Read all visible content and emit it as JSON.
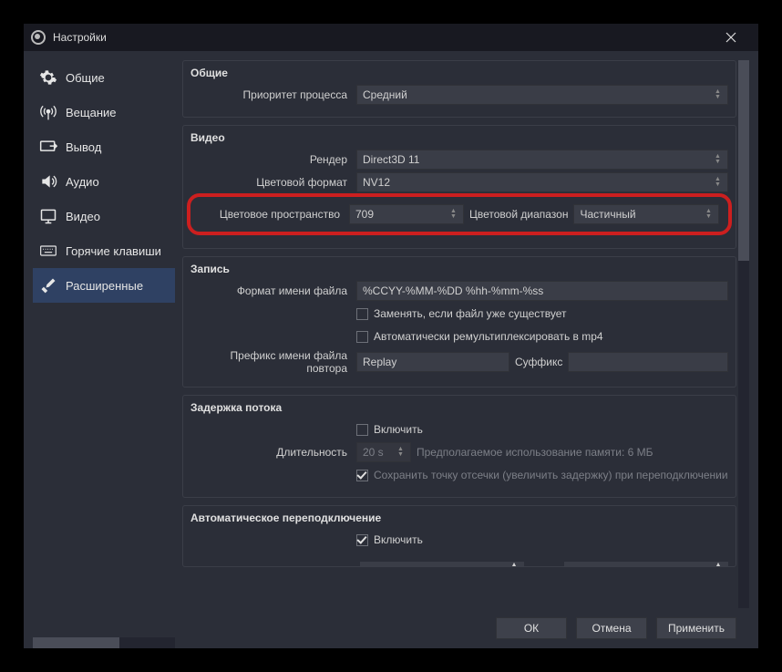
{
  "window": {
    "title": "Настройки"
  },
  "sidebar": {
    "items": [
      {
        "label": "Общие"
      },
      {
        "label": "Вещание"
      },
      {
        "label": "Вывод"
      },
      {
        "label": "Аудио"
      },
      {
        "label": "Видео"
      },
      {
        "label": "Горячие клавиши"
      },
      {
        "label": "Расширенные"
      }
    ]
  },
  "general": {
    "title": "Общие",
    "priority_label": "Приоритет процесса",
    "priority_value": "Средний"
  },
  "video": {
    "title": "Видео",
    "renderer_label": "Рендер",
    "renderer_value": "Direct3D 11",
    "color_format_label": "Цветовой формат",
    "color_format_value": "NV12",
    "color_space_label": "Цветовое пространство",
    "color_space_value": "709",
    "color_range_label": "Цветовой диапазон",
    "color_range_value": "Частичный"
  },
  "recording": {
    "title": "Запись",
    "filename_label": "Формат имени файла",
    "filename_value": "%CCYY-%MM-%DD %hh-%mm-%ss",
    "overwrite_label": "Заменять, если файл уже существует",
    "remux_label": "Автоматически ремультиплексировать в mp4",
    "replay_prefix_label": "Префикс имени файла повтора",
    "replay_prefix_value": "Replay",
    "suffix_label": "Суффикс",
    "suffix_value": ""
  },
  "delay": {
    "title": "Задержка потока",
    "enable_label": "Включить",
    "duration_label": "Длительность",
    "duration_value": "20 s",
    "memory_label": "Предполагаемое использование памяти: 6 МБ",
    "preserve_label": "Сохранить точку отсечки (увеличить задержку) при переподключении"
  },
  "reconnect": {
    "title": "Автоматическое переподключение",
    "enable_label": "Включить"
  },
  "footer": {
    "ok": "ОК",
    "cancel": "Отмена",
    "apply": "Применить"
  }
}
